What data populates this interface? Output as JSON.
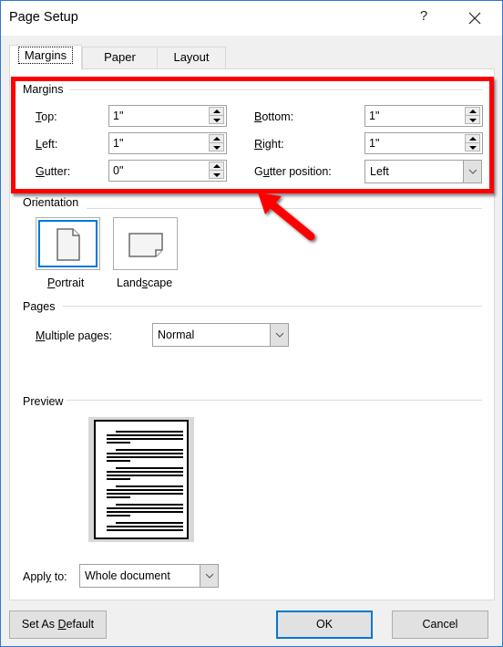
{
  "window": {
    "title": "Page Setup",
    "help_label": "?",
    "close_icon": "close-icon"
  },
  "tabs": [
    {
      "label": "Margins",
      "active": true
    },
    {
      "label": "Paper",
      "active": false
    },
    {
      "label": "Layout",
      "active": false
    }
  ],
  "margins": {
    "group_label": "Margins",
    "top": {
      "label_u": "T",
      "label_rest": "op:",
      "value": "1\""
    },
    "bottom": {
      "label_u": "B",
      "label_rest": "ottom:",
      "value": "1\""
    },
    "left": {
      "label_u": "L",
      "label_rest": "eft:",
      "value": "1\""
    },
    "right": {
      "label_u": "R",
      "label_rest": "ight:",
      "value": "1\""
    },
    "gutter": {
      "label_u": "G",
      "label_rest": "utter:",
      "value": "0\""
    },
    "gutter_position": {
      "label_pre": "G",
      "label_u": "u",
      "label_rest": "tter position:",
      "value": "Left"
    }
  },
  "orientation": {
    "group_label": "Orientation",
    "portrait": {
      "label_u": "P",
      "label_rest": "ortrait",
      "selected": true
    },
    "landscape": {
      "label_pre": "Land",
      "label_u": "s",
      "label_rest": "cape",
      "selected": false
    }
  },
  "pages": {
    "group_label": "Pages",
    "multiple_pages": {
      "label_u": "M",
      "label_rest": "ultiple pages:",
      "value": "Normal"
    }
  },
  "preview": {
    "group_label": "Preview"
  },
  "apply_to": {
    "label_pre": "Appl",
    "label_u": "y",
    "label_rest": " to:",
    "value": "Whole document"
  },
  "buttons": {
    "set_default_pre": "Set As ",
    "set_default_u": "D",
    "set_default_rest": "efault",
    "ok": "OK",
    "cancel": "Cancel"
  },
  "annotation": {
    "highlight_color": "#ff0000",
    "accent_color": "#0078d7"
  }
}
